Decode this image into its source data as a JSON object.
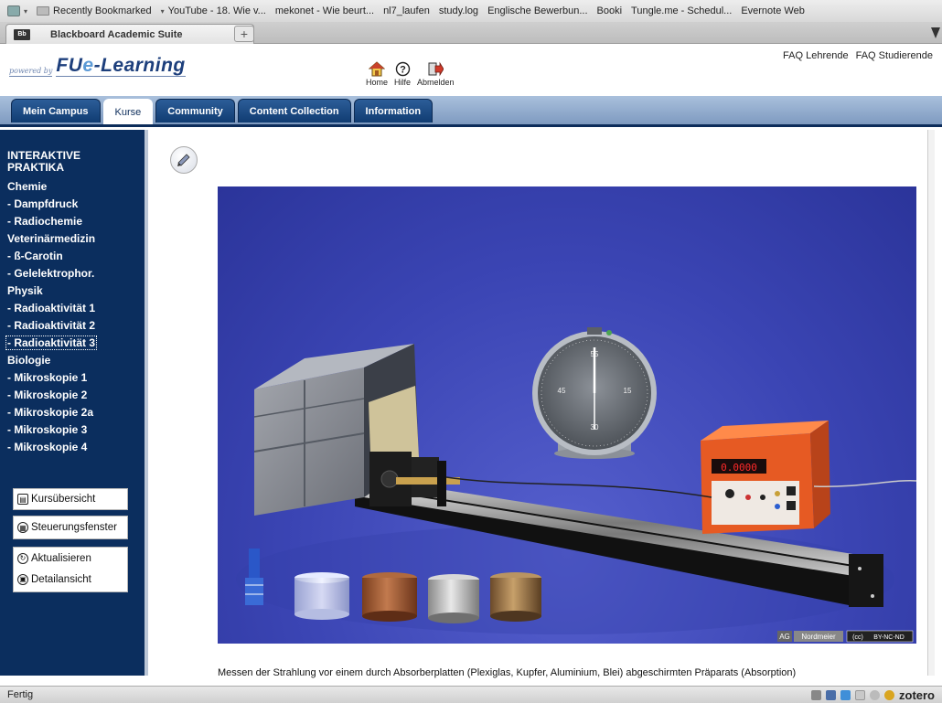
{
  "browser": {
    "bookmarks": [
      {
        "label": "Recently Bookmarked"
      },
      {
        "label": "YouTube - 18. Wie v..."
      },
      {
        "label": "mekonet - Wie beurt..."
      },
      {
        "label": "nl7_laufen"
      },
      {
        "label": "study.log"
      },
      {
        "label": "Englische Bewerbun..."
      },
      {
        "label": "Booki"
      },
      {
        "label": "Tungle.me - Schedul..."
      },
      {
        "label": "Evernote Web"
      }
    ],
    "active_tab": {
      "icon_text": "Bb",
      "title": "Blackboard Academic Suite"
    },
    "new_tab_label": "+",
    "status": "Fertig",
    "zotero": "zotero"
  },
  "header": {
    "powered_by": "powered by",
    "brand_prefix": "FU",
    "brand_mid": "e",
    "brand_suffix": "-Learning",
    "topnav": [
      {
        "label": "Home",
        "icon": "home-icon"
      },
      {
        "label": "Hilfe",
        "icon": "help-icon"
      },
      {
        "label": "Abmelden",
        "icon": "logout-icon"
      }
    ],
    "faq": [
      "FAQ Lehrende",
      "FAQ Studierende"
    ]
  },
  "mainnav": {
    "tabs": [
      {
        "label": "Mein Campus",
        "active": false
      },
      {
        "label": "Kurse",
        "active": true
      },
      {
        "label": "Community",
        "active": false
      },
      {
        "label": "Content Collection",
        "active": false
      },
      {
        "label": "Information",
        "active": false
      }
    ]
  },
  "sidebar": {
    "title": "INTERAKTIVE PRAKTIKA",
    "groups": [
      {
        "name": "Chemie",
        "items": [
          "- Dampfdruck",
          "- Radiochemie"
        ]
      },
      {
        "name": "Veterinärmedizin",
        "items": [
          "- ß-Carotin",
          "- Gelelektrophor."
        ]
      },
      {
        "name": "Physik",
        "items": [
          "- Radioaktivität 1",
          "- Radioaktivität 2",
          "- Radioaktivität 3"
        ]
      },
      {
        "name": "Biologie",
        "items": [
          "- Mikroskopie 1",
          "- Mikroskopie 2",
          "- Mikroskopie 2a",
          "- Mikroskopie 3",
          "- Mikroskopie 4"
        ]
      }
    ],
    "selected_item": "- Radioaktivität 3",
    "buttons": {
      "kursuebersicht": "Kursübersicht",
      "steuerungsfenster": "Steuerungsfenster",
      "aktualisieren": "Aktualisieren",
      "detailansicht": "Detailansicht"
    }
  },
  "content": {
    "photo_credit_author": "AG",
    "photo_credit_name": "Nordmeier",
    "photo_license": "BY-NC-ND",
    "photo_license_cc": "(cc)",
    "caption": "Messen der Strahlung vor einem durch Absorberplatten (Plexiglas, Kupfer, Aluminium, Blei) abgeschirmten Präparats (Absorption)",
    "counter_display": "0.0000"
  },
  "colors": {
    "sidebar_bg": "#0b2e5e",
    "nav_tab": "#1b4a85",
    "photo_bg": "#3b45b4"
  }
}
